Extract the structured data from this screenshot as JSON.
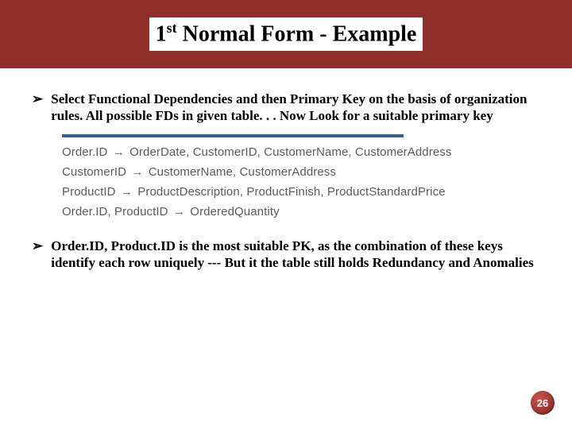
{
  "title": {
    "prefix": "1",
    "super": "st",
    "rest": " Normal Form - Example"
  },
  "bullets": {
    "marker": "➢",
    "first": "Select Functional Dependencies and then Primary Key on the basis of organization rules. All possible FDs in given table. . . Now Look for a suitable primary key",
    "second": "Order.ID, Product.ID is the most suitable PK, as the combination of these keys identify each row uniquely --- But it the table still holds Redundancy and Anomalies"
  },
  "fds": {
    "arrow": "→",
    "line1_lhs": "Order.ID",
    "line1_rhs": "OrderDate, CustomerID, CustomerName, CustomerAddress",
    "line2_lhs": "CustomerID",
    "line2_rhs": "CustomerName, CustomerAddress",
    "line3_lhs": "ProductID",
    "line3_rhs": "ProductDescription, ProductFinish, ProductStandardPrice",
    "line4_lhs": "Order.ID, ProductID",
    "line4_rhs": "OrderedQuantity"
  },
  "page_number": "26"
}
